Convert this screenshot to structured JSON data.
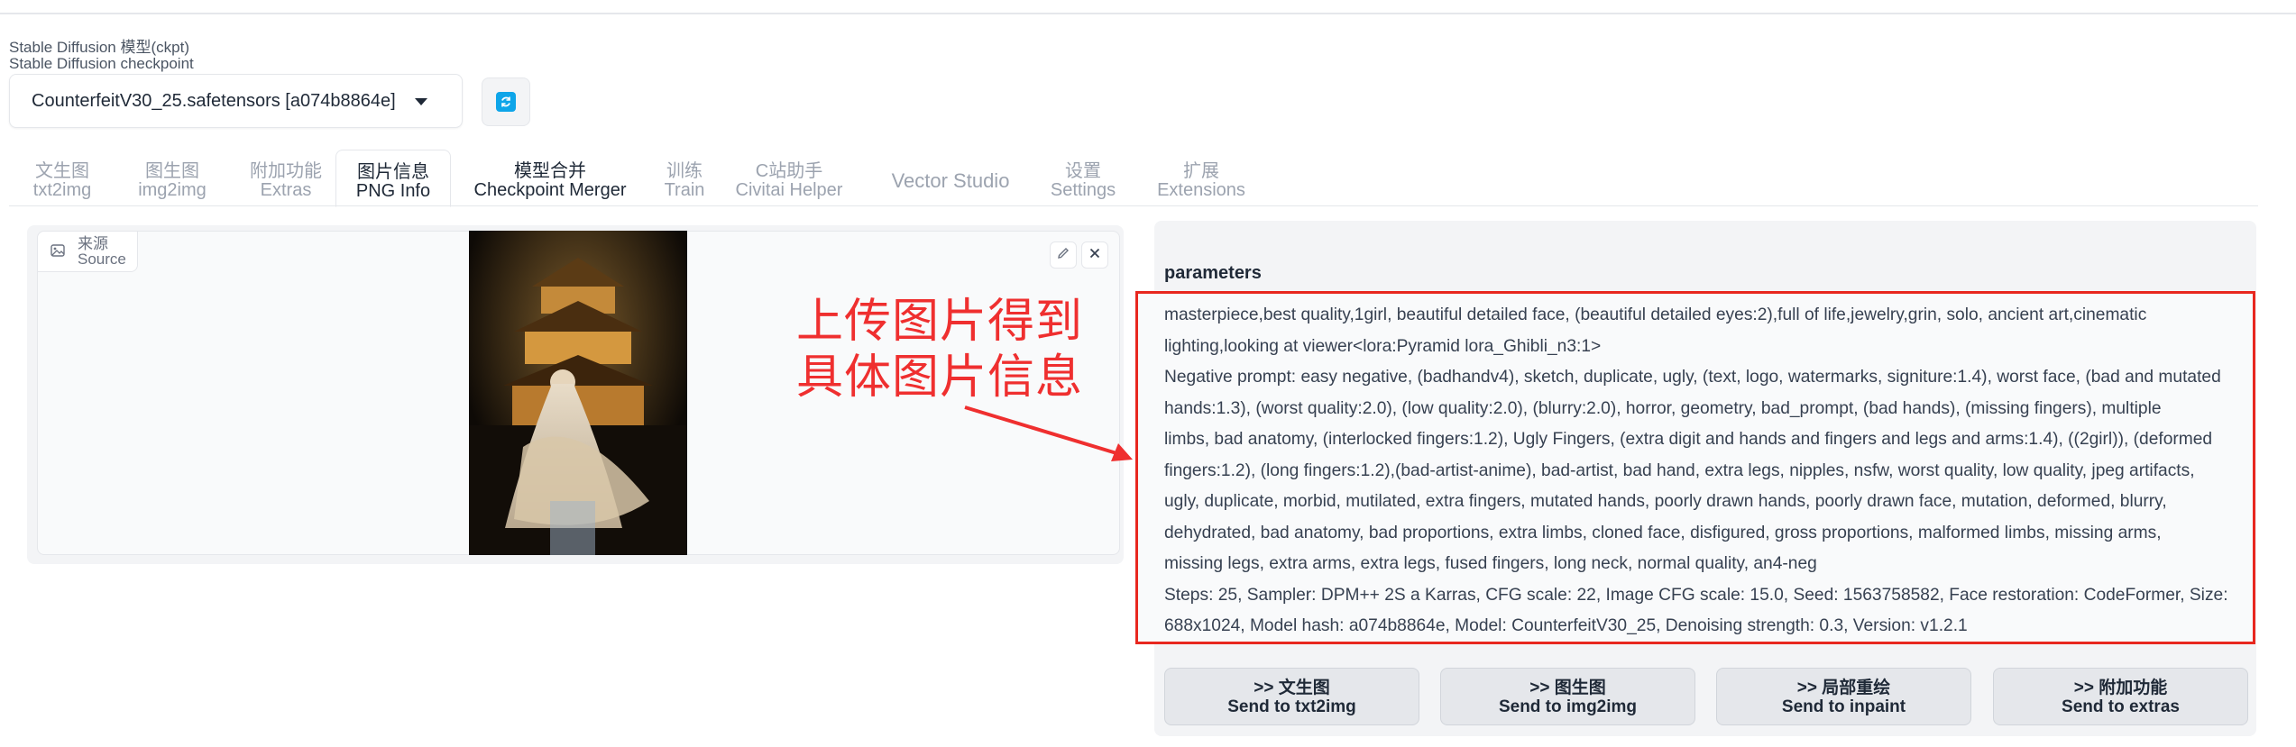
{
  "checkpoint": {
    "label_zh": "Stable Diffusion 模型(ckpt)",
    "label_en": "Stable Diffusion checkpoint",
    "selected": "CounterfeitV30_25.safetensors [a074b8864e]"
  },
  "tabs": [
    {
      "zh": "文生图",
      "en": "txt2img"
    },
    {
      "zh": "图生图",
      "en": "img2img"
    },
    {
      "zh": "附加功能",
      "en": "Extras"
    },
    {
      "zh": "图片信息",
      "en": "PNG Info"
    },
    {
      "zh": "模型合并",
      "en": "Checkpoint Merger"
    },
    {
      "zh": "训练",
      "en": "Train"
    },
    {
      "zh": "C站助手",
      "en": "Civitai Helper"
    },
    {
      "zh": "Vector Studio",
      "en": ""
    },
    {
      "zh": "设置",
      "en": "Settings"
    },
    {
      "zh": "扩展",
      "en": "Extensions"
    }
  ],
  "source": {
    "zh": "来源",
    "en": "Source"
  },
  "annotation": {
    "line1": "上传图片得到",
    "line2": "具体图片信息"
  },
  "parameters": {
    "label": "parameters",
    "lines": [
      "masterpiece,best quality,1girl, beautiful detailed face, (beautiful detailed eyes:2),full of life,jewelry,grin, solo, ancient art,cinematic",
      "lighting,looking at viewer<lora:Pyramid lora_Ghibli_n3:1>",
      "Negative prompt: easy negative, (badhandv4), sketch, duplicate, ugly, (text, logo, watermarks, signiture:1.4), worst face, (bad and mutated",
      "hands:1.3), (worst quality:2.0), (low quality:2.0), (blurry:2.0), horror, geometry, bad_prompt, (bad hands), (missing fingers), multiple",
      "limbs, bad anatomy, (interlocked fingers:1.2), Ugly Fingers, (extra digit and hands and fingers and legs and arms:1.4), ((2girl)), (deformed",
      "fingers:1.2), (long fingers:1.2),(bad-artist-anime), bad-artist, bad hand, extra legs, nipples, nsfw, worst quality, low quality, jpeg artifacts,",
      "ugly, duplicate, morbid, mutilated, extra fingers, mutated hands, poorly drawn hands, poorly drawn face, mutation, deformed, blurry,",
      "dehydrated, bad anatomy, bad proportions, extra limbs, cloned face, disfigured, gross proportions, malformed limbs, missing arms,",
      "missing legs, extra arms, extra legs, fused fingers, long neck, normal quality, an4-neg",
      "Steps: 25, Sampler: DPM++ 2S a Karras, CFG scale: 22, Image CFG scale: 15.0, Seed: 1563758582, Face restoration: CodeFormer, Size:",
      "688x1024, Model hash: a074b8864e, Model: CounterfeitV30_25, Denoising strength: 0.3, Version: v1.2.1"
    ]
  },
  "send_buttons": [
    {
      "zh": ">> 文生图",
      "en": "Send to txt2img"
    },
    {
      "zh": ">> 图生图",
      "en": "Send to img2img"
    },
    {
      "zh": ">> 局部重绘",
      "en": "Send to inpaint"
    },
    {
      "zh": ">> 附加功能",
      "en": "Send to extras"
    }
  ],
  "colors": {
    "annotation": "#ef2f2f",
    "accent": "#0ea5e9"
  }
}
